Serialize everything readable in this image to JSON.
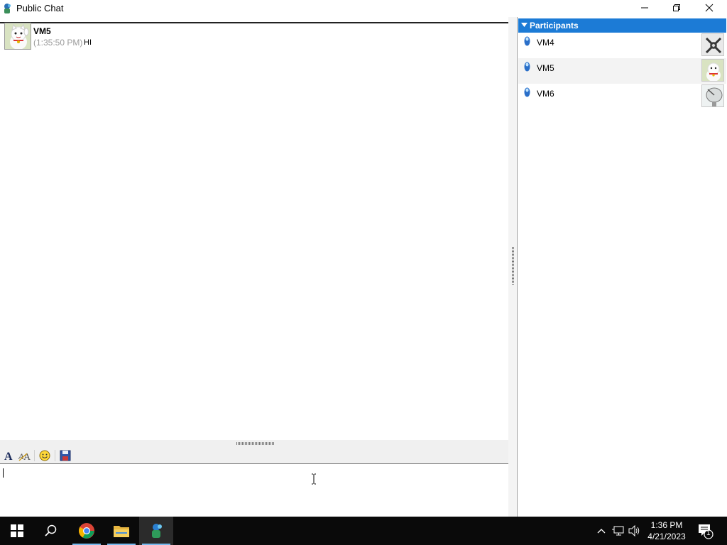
{
  "window": {
    "title": "Public Chat"
  },
  "chat": {
    "messages": [
      {
        "sender": "VM5",
        "time": "(1:35:50 PM)",
        "text": "HI"
      }
    ]
  },
  "participants": {
    "header": "Participants",
    "items": [
      {
        "name": "VM4"
      },
      {
        "name": "VM5"
      },
      {
        "name": "VM6"
      }
    ]
  },
  "toolbar": {
    "icons": [
      "font-icon",
      "font-style-icon",
      "smiley-icon",
      "save-icon"
    ]
  },
  "taskbar": {
    "time": "1:36 PM",
    "date": "4/21/2023",
    "notification_count": "1"
  },
  "colors": {
    "participants_header": "#1c7bd6",
    "taskbar": "#0a0a0a",
    "taskbar_accent": "#76b9ed"
  }
}
